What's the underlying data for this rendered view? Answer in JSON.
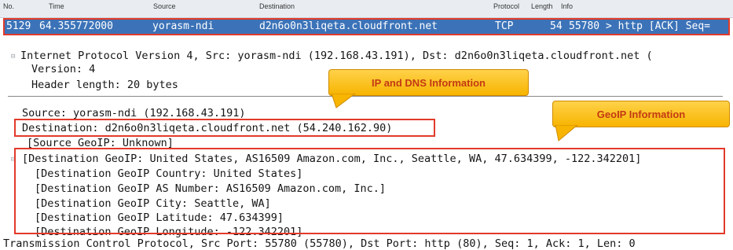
{
  "header": {
    "col_no": "No.",
    "col_time": "Time",
    "col_source": "Source",
    "col_destination": "Destination",
    "col_protocol": "Protocol",
    "col_length": "Length",
    "col_info": "Info"
  },
  "packet_row": {
    "no": "5129",
    "time": "64.355772000",
    "source": "yorasm-ndi",
    "destination": "d2n6o0n3liqeta.cloudfront.net",
    "protocol": "TCP",
    "length": "54",
    "info": "55780 > http [ACK] Seq="
  },
  "details": {
    "ip_line": "Internet Protocol Version 4, Src: yorasm-ndi (192.168.43.191), Dst: d2n6o0n3liqeta.cloudfront.net (",
    "version": "Version: 4",
    "header_length": "Header length: 20 bytes",
    "source": "Source: yorasm-ndi (192.168.43.191)",
    "destination": "Destination: d2n6o0n3liqeta.cloudfront.net (54.240.162.90)",
    "source_geoip": "[Source GeoIP: Unknown]",
    "dest_geoip": "[Destination GeoIP: United States, AS16509 Amazon.com, Inc., Seattle, WA, 47.634399, -122.342201]",
    "geo_country": "[Destination GeoIP Country: United States]",
    "geo_as": "[Destination GeoIP AS Number: AS16509 Amazon.com, Inc.]",
    "geo_city": "[Destination GeoIP City: Seattle, WA]",
    "geo_lat": "[Destination GeoIP Latitude: 47.634399]",
    "geo_lon": "[Destination GeoIP Longitude: -122.342201]",
    "tcp_line": "Transmission Control Protocol, Src Port: 55780 (55780), Dst Port: http (80), Seq: 1, Ack: 1, Len: 0"
  },
  "callouts": {
    "ip_dns": "IP and DNS Information",
    "geoip": "GeoIP Information"
  },
  "colors": {
    "selected_row": "#3c73b8",
    "highlight_box": "#e23a2a",
    "callout_fill": "#f7b400",
    "callout_text": "#c33a14"
  }
}
